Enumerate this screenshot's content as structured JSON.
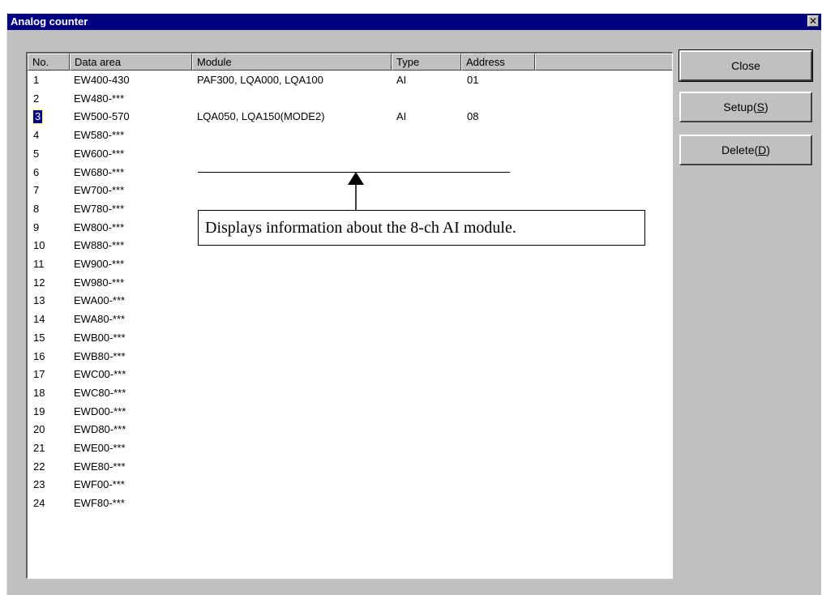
{
  "window": {
    "title": "Analog counter",
    "close_glyph": "✕"
  },
  "list": {
    "columns": [
      "No.",
      "Data area",
      "Module",
      "Type",
      "Address"
    ],
    "rows": [
      {
        "no": "1",
        "area": "EW400-430",
        "module": "PAF300, LQA000, LQA100",
        "type": "AI",
        "address": "01"
      },
      {
        "no": "2",
        "area": "EW480-***",
        "module": "",
        "type": "",
        "address": ""
      },
      {
        "no": "3",
        "area": "EW500-570",
        "module": "LQA050, LQA150(MODE2)",
        "type": "AI",
        "address": "08"
      },
      {
        "no": "4",
        "area": "EW580-***",
        "module": "",
        "type": "",
        "address": ""
      },
      {
        "no": "5",
        "area": "EW600-***",
        "module": "",
        "type": "",
        "address": ""
      },
      {
        "no": "6",
        "area": "EW680-***",
        "module": "",
        "type": "",
        "address": ""
      },
      {
        "no": "7",
        "area": "EW700-***",
        "module": "",
        "type": "",
        "address": ""
      },
      {
        "no": "8",
        "area": "EW780-***",
        "module": "",
        "type": "",
        "address": ""
      },
      {
        "no": "9",
        "area": "EW800-***",
        "module": "",
        "type": "",
        "address": ""
      },
      {
        "no": "10",
        "area": "EW880-***",
        "module": "",
        "type": "",
        "address": ""
      },
      {
        "no": "11",
        "area": "EW900-***",
        "module": "",
        "type": "",
        "address": ""
      },
      {
        "no": "12",
        "area": "EW980-***",
        "module": "",
        "type": "",
        "address": ""
      },
      {
        "no": "13",
        "area": "EWA00-***",
        "module": "",
        "type": "",
        "address": ""
      },
      {
        "no": "14",
        "area": "EWA80-***",
        "module": "",
        "type": "",
        "address": ""
      },
      {
        "no": "15",
        "area": "EWB00-***",
        "module": "",
        "type": "",
        "address": ""
      },
      {
        "no": "16",
        "area": "EWB80-***",
        "module": "",
        "type": "",
        "address": ""
      },
      {
        "no": "17",
        "area": "EWC00-***",
        "module": "",
        "type": "",
        "address": ""
      },
      {
        "no": "18",
        "area": "EWC80-***",
        "module": "",
        "type": "",
        "address": ""
      },
      {
        "no": "19",
        "area": "EWD00-***",
        "module": "",
        "type": "",
        "address": ""
      },
      {
        "no": "20",
        "area": "EWD80-***",
        "module": "",
        "type": "",
        "address": ""
      },
      {
        "no": "21",
        "area": "EWE00-***",
        "module": "",
        "type": "",
        "address": ""
      },
      {
        "no": "22",
        "area": "EWE80-***",
        "module": "",
        "type": "",
        "address": ""
      },
      {
        "no": "23",
        "area": "EWF00-***",
        "module": "",
        "type": "",
        "address": ""
      },
      {
        "no": "24",
        "area": "EWF80-***",
        "module": "",
        "type": "",
        "address": ""
      }
    ],
    "selected_no": "3"
  },
  "annotation": {
    "text": "Displays information about the 8-ch AI module."
  },
  "buttons": {
    "close": {
      "label": "Close"
    },
    "setup": {
      "label": "Setup(",
      "mnemonic": "S",
      "suffix": ")"
    },
    "delete": {
      "label": "Delete(",
      "mnemonic": "D",
      "suffix": ")"
    }
  }
}
